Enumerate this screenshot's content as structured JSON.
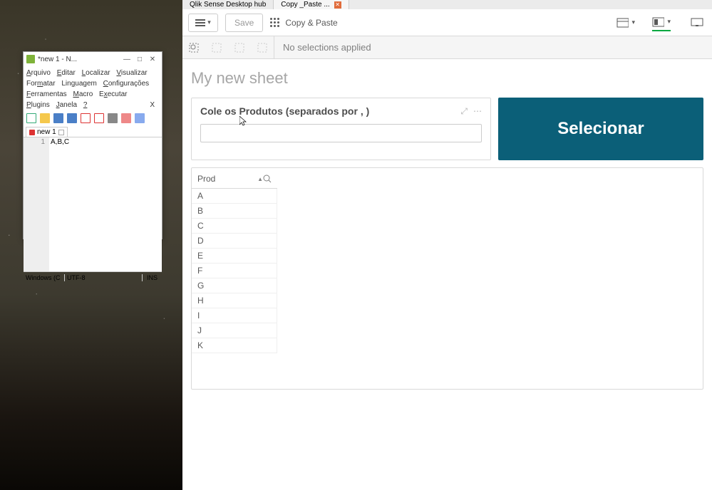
{
  "notepad": {
    "title": "*new 1 - N...",
    "menu": {
      "row1": [
        "Arquivo",
        "Editar",
        "Localizar",
        "Visualizar"
      ],
      "row2": [
        "Formatar",
        "Linguagem",
        "Configurações"
      ],
      "row3": [
        "Ferramentas",
        "Macro",
        "Executar"
      ],
      "row4": [
        "Plugins",
        "Janela",
        "?"
      ],
      "x": "X"
    },
    "tab": "new 1",
    "line_no": "1",
    "content": "A,B,C",
    "status": {
      "left": "Windows (C",
      "mid": "UTF-8",
      "right": "INS"
    }
  },
  "qlik": {
    "tabs": {
      "hub": "Qlik Sense Desktop hub",
      "app": "Copy _Paste ..."
    },
    "toolbar": {
      "save": "Save",
      "app_name": "Copy & Paste"
    },
    "selection_bar": "No selections applied",
    "sheet_title": "My new sheet",
    "input_card": {
      "title": "Cole os Produtos (separados por , )",
      "value": ""
    },
    "button": "Selecionar",
    "table": {
      "header": "Prod",
      "rows": [
        "A",
        "B",
        "C",
        "D",
        "E",
        "F",
        "G",
        "H",
        "I",
        "J",
        "K"
      ]
    }
  }
}
